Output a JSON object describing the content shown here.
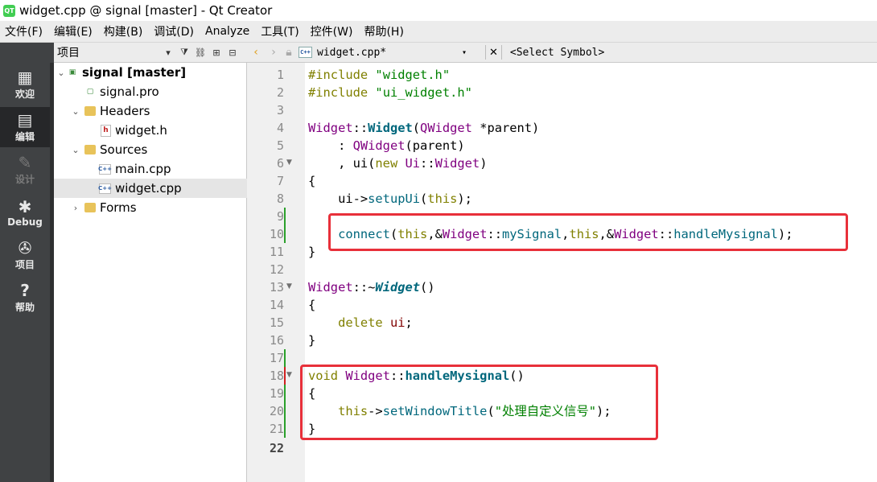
{
  "window": {
    "title": "widget.cpp @ signal [master] - Qt Creator",
    "logo_text": "QT"
  },
  "menu": [
    "文件(F)",
    "编辑(E)",
    "构建(B)",
    "调试(D)",
    "Analyze",
    "工具(T)",
    "控件(W)",
    "帮助(H)"
  ],
  "modes": [
    {
      "label": "欢迎",
      "icon": "grid-icon"
    },
    {
      "label": "编辑",
      "icon": "edit-icon"
    },
    {
      "label": "设计",
      "icon": "pencil-icon"
    },
    {
      "label": "Debug",
      "icon": "bug-icon"
    },
    {
      "label": "项目",
      "icon": "wrench-icon"
    },
    {
      "label": "帮助",
      "icon": "help-icon"
    }
  ],
  "project_panel": {
    "title": "项目",
    "tree": [
      {
        "label": "signal [master]",
        "kind": "project"
      },
      {
        "label": "signal.pro",
        "kind": "pro"
      },
      {
        "label": "Headers",
        "kind": "folder"
      },
      {
        "label": "widget.h",
        "kind": "header"
      },
      {
        "label": "Sources",
        "kind": "folder"
      },
      {
        "label": "main.cpp",
        "kind": "source"
      },
      {
        "label": "widget.cpp",
        "kind": "source",
        "selected": true
      },
      {
        "label": "Forms",
        "kind": "folder"
      }
    ]
  },
  "editor": {
    "file": "widget.cpp*",
    "file_badge": "C++",
    "symbol": "<Select Symbol>",
    "line_numbers": [
      "1",
      "2",
      "3",
      "4",
      "5",
      "6",
      "7",
      "8",
      "9",
      "10",
      "11",
      "12",
      "13",
      "14",
      "15",
      "16",
      "17",
      "18",
      "19",
      "20",
      "21",
      "22"
    ],
    "current_line": "22",
    "highlight_color": "#e8303a",
    "code": {
      "l1_kw": "#include",
      "l1_str": "\"widget.h\"",
      "l2_kw": "#include",
      "l2_str": "\"ui_widget.h\"",
      "l4_cls": "Widget",
      "l4_sep": "::",
      "l4_fn": "Widget",
      "l4_open": "(",
      "l4_type": "QWidget",
      "l4_rest": " *parent)",
      "l5_colon": "    : ",
      "l5_type": "QWidget",
      "l5_rest": "(parent)",
      "l6_comma": "    , ui(",
      "l6_kw": "new",
      "l6_sp": " ",
      "l6_type": "Ui",
      "l6_sep": "::",
      "l6_type2": "Widget",
      "l6_close": ")",
      "l7": "{",
      "l8_ind": "    ui->",
      "l8_fn": "setupUi",
      "l8_open": "(",
      "l8_kw": "this",
      "l8_close": ");",
      "l10_ind": "    ",
      "l10_fn": "connect",
      "l10_open": "(",
      "l10_kw1": "this",
      "l10_amp1": ",&",
      "l10_cls1": "Widget",
      "l10_sep1": "::",
      "l10_fn1": "mySignal",
      "l10_comma": ",",
      "l10_kw2": "this",
      "l10_amp2": ",&",
      "l10_cls2": "Widget",
      "l10_sep2": "::",
      "l10_fn2": "handleMysignal",
      "l10_close": ");",
      "l11": "}",
      "l13_cls": "Widget",
      "l13_sep": "::~",
      "l13_fn": "Widget",
      "l13_rest": "()",
      "l14": "{",
      "l15_ind": "    ",
      "l15_kw": "delete",
      "l15_sp": " ",
      "l15_mem": "ui",
      "l15_end": ";",
      "l16": "}",
      "l18_kw": "void",
      "l18_sp": " ",
      "l18_cls": "Widget",
      "l18_sep": "::",
      "l18_fn": "handleMysignal",
      "l18_rest": "()",
      "l19": "{",
      "l20_ind": "    ",
      "l20_kw": "this",
      "l20_arrow": "->",
      "l20_fn": "setWindowTitle",
      "l20_open": "(",
      "l20_str": "\"处理自定义信号\"",
      "l20_close": ");",
      "l21": "}"
    }
  }
}
